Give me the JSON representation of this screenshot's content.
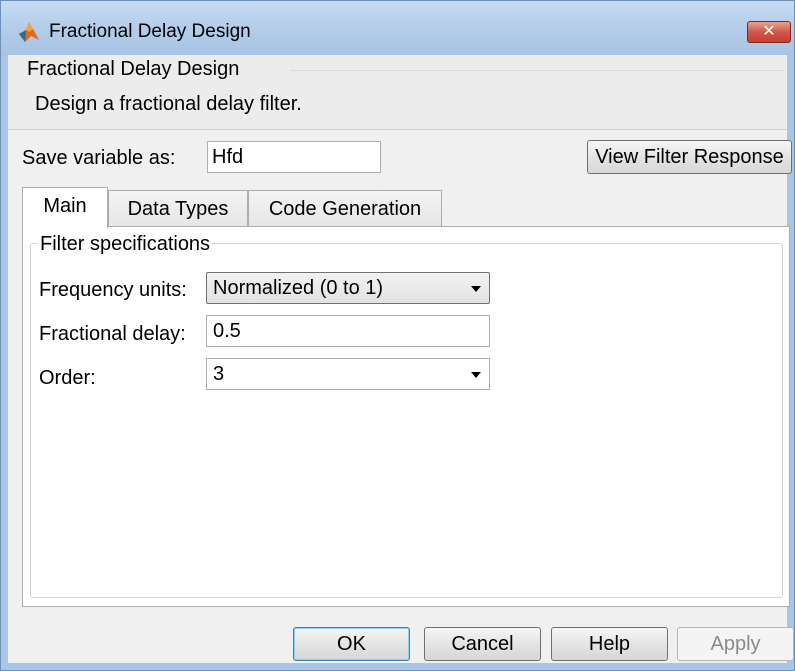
{
  "window": {
    "title": "Fractional Delay Design",
    "close_glyph": "✕",
    "icon": "matlab-logo-icon"
  },
  "header": {
    "title": "Fractional Delay Design",
    "description": "Design a fractional delay filter."
  },
  "save": {
    "label": "Save variable as:",
    "value": "Hfd"
  },
  "view_button": "View Filter Response",
  "tabs": [
    {
      "label": "Main",
      "active": true
    },
    {
      "label": "Data Types",
      "active": false
    },
    {
      "label": "Code Generation",
      "active": false
    }
  ],
  "specs": {
    "title": "Filter specifications",
    "frequency_units": {
      "label": "Frequency units:",
      "value": "Normalized (0 to 1)"
    },
    "fractional_delay": {
      "label": "Fractional delay:",
      "value": "0.5"
    },
    "order": {
      "label": "Order:",
      "value": "3"
    }
  },
  "buttons": {
    "ok": "OK",
    "cancel": "Cancel",
    "help": "Help",
    "apply": "Apply"
  },
  "colors": {
    "titlebar": "#b3cce9",
    "close_button": "#c63e2f",
    "ok_focus_border": "#3c7fb1"
  }
}
